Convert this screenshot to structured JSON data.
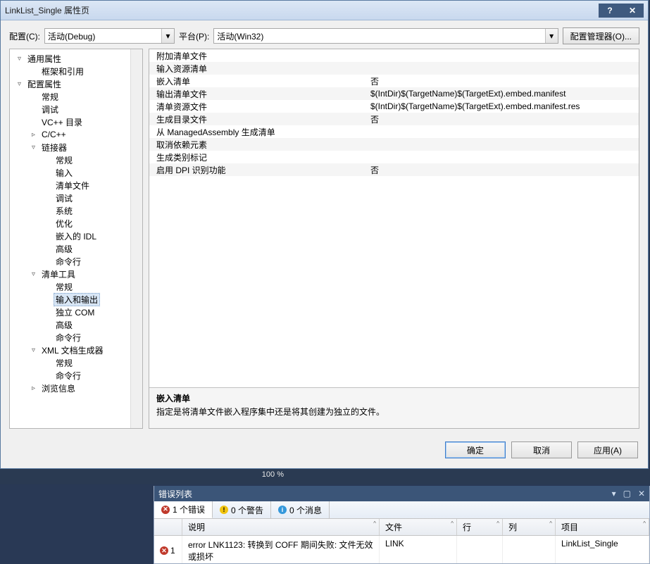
{
  "titlebar": {
    "title": "LinkList_Single 属性页"
  },
  "ghost_tabs": [
    "",
    "",
    ""
  ],
  "toprow": {
    "config_label": "配置(C):",
    "config_value": "活动(Debug)",
    "platform_label": "平台(P):",
    "platform_value": "活动(Win32)",
    "cfg_mgr_btn": "配置管理器(O)..."
  },
  "tree": [
    {
      "level": 0,
      "exp": "▿",
      "label": "通用属性"
    },
    {
      "level": 1,
      "exp": "",
      "label": "框架和引用"
    },
    {
      "level": 0,
      "exp": "▿",
      "label": "配置属性"
    },
    {
      "level": 1,
      "exp": "",
      "label": "常规"
    },
    {
      "level": 1,
      "exp": "",
      "label": "调试"
    },
    {
      "level": 1,
      "exp": "",
      "label": "VC++ 目录"
    },
    {
      "level": 1,
      "exp": "▹",
      "label": "C/C++"
    },
    {
      "level": 1,
      "exp": "▿",
      "label": "链接器"
    },
    {
      "level": 2,
      "exp": "",
      "label": "常规"
    },
    {
      "level": 2,
      "exp": "",
      "label": "输入"
    },
    {
      "level": 2,
      "exp": "",
      "label": "清单文件"
    },
    {
      "level": 2,
      "exp": "",
      "label": "调试"
    },
    {
      "level": 2,
      "exp": "",
      "label": "系统"
    },
    {
      "level": 2,
      "exp": "",
      "label": "优化"
    },
    {
      "level": 2,
      "exp": "",
      "label": "嵌入的 IDL"
    },
    {
      "level": 2,
      "exp": "",
      "label": "高级"
    },
    {
      "level": 2,
      "exp": "",
      "label": "命令行"
    },
    {
      "level": 1,
      "exp": "▿",
      "label": "清单工具"
    },
    {
      "level": 2,
      "exp": "",
      "label": "常规"
    },
    {
      "level": 2,
      "exp": "",
      "label": "输入和输出",
      "selected": true
    },
    {
      "level": 2,
      "exp": "",
      "label": "独立 COM"
    },
    {
      "level": 2,
      "exp": "",
      "label": "高级"
    },
    {
      "level": 2,
      "exp": "",
      "label": "命令行"
    },
    {
      "level": 1,
      "exp": "▿",
      "label": "XML 文档生成器"
    },
    {
      "level": 2,
      "exp": "",
      "label": "常规"
    },
    {
      "level": 2,
      "exp": "",
      "label": "命令行"
    },
    {
      "level": 1,
      "exp": "▹",
      "label": "浏览信息"
    }
  ],
  "props": [
    {
      "name": "附加清单文件",
      "value": ""
    },
    {
      "name": "输入资源清单",
      "value": ""
    },
    {
      "name": "嵌入清单",
      "value": "否"
    },
    {
      "name": "输出清单文件",
      "value": "$(IntDir)$(TargetName)$(TargetExt).embed.manifest"
    },
    {
      "name": "清单资源文件",
      "value": "$(IntDir)$(TargetName)$(TargetExt).embed.manifest.res"
    },
    {
      "name": "生成目录文件",
      "value": "否"
    },
    {
      "name": "从 ManagedAssembly 生成清单",
      "value": ""
    },
    {
      "name": "取消依赖元素",
      "value": ""
    },
    {
      "name": "生成类别标记",
      "value": ""
    },
    {
      "name": "启用 DPI 识别功能",
      "value": "否"
    }
  ],
  "desc": {
    "title": "嵌入清单",
    "text": "指定是将清单文件嵌入程序集中还是将其创建为独立的文件。"
  },
  "footer": {
    "ok": "确定",
    "cancel": "取消",
    "apply": "应用(A)"
  },
  "zoom": "100 %",
  "errorlist": {
    "title": "错误列表",
    "tabs": {
      "errors": "1 个错误",
      "warnings": "0 个警告",
      "messages": "0 个消息"
    },
    "columns": {
      "num": "",
      "desc": "说明",
      "file": "文件",
      "line": "行",
      "col": "列",
      "proj": "项目"
    },
    "rows": [
      {
        "num": "1",
        "desc": "error LNK1123: 转换到 COFF 期间失败: 文件无效或损坏",
        "file": "LINK",
        "line": "",
        "col": "",
        "proj": "LinkList_Single"
      }
    ]
  }
}
